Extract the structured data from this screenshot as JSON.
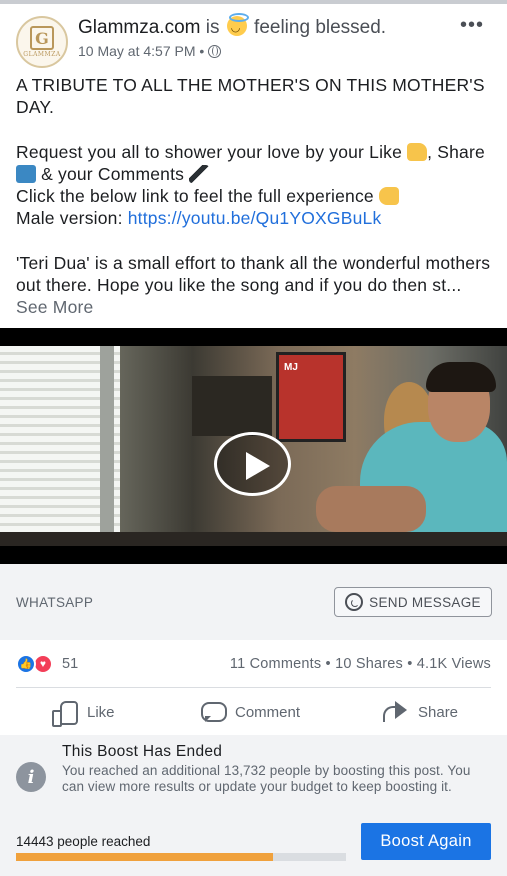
{
  "post": {
    "page_name": "Glammza.com",
    "status_prefix": "is",
    "emoji_icon": "smiling-face-with-halo",
    "status_suffix": "feeling blessed.",
    "timestamp": "10 May at 4:57 PM",
    "separator": "•",
    "privacy_icon": "globe-icon",
    "avatar_letter": "G",
    "avatar_word": "GLAMMZA",
    "more_label": "•••"
  },
  "body": {
    "line1": "A TRIBUTE TO ALL THE MOTHER'S ON THIS MOTHER'S DAY.",
    "line2_part1": "Request you all to shower your love by your Like",
    "line2_part2": ", Share",
    "line2_part3": "& your Comments",
    "line3": "Click the below link to feel the full experience",
    "male_prefix": "Male version: ",
    "link": "https://youtu.be/Qu1YOXGBuLk",
    "para3": "'Teri Dua' is a small effort to thank all the wonderful mothers out there. Hope you like the song and if you do then st...",
    "see_more": "See More"
  },
  "video": {
    "poster_text": "MJ"
  },
  "cta": {
    "label": "WHATSAPP",
    "button": "SEND MESSAGE"
  },
  "engagement": {
    "reaction_count": "51",
    "comments": "11 Comments",
    "shares": "10 Shares",
    "views": "4.1K Views",
    "dot": "•"
  },
  "actions": {
    "like": "Like",
    "comment": "Comment",
    "share": "Share"
  },
  "boost": {
    "title": "This Boost Has Ended",
    "description": "You reached an additional 13,732 people by boosting this post. You can view more results or update your budget to keep boosting it.",
    "reach_label": "14443 people reached",
    "reach_fraction": 0.78,
    "button": "Boost Again",
    "button_color": "#1b74e4",
    "bar_color": "#f0a13c"
  }
}
